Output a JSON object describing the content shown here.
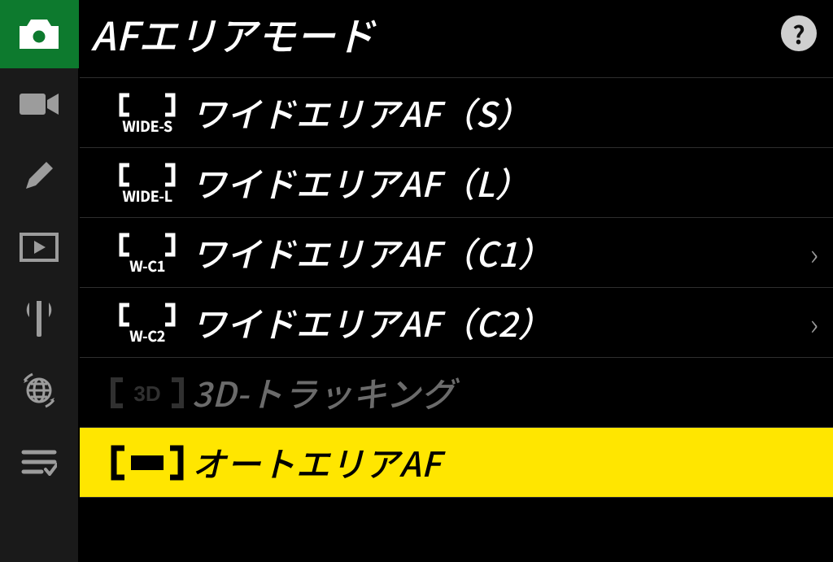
{
  "header": {
    "title": "AFエリアモード",
    "help_label": "?"
  },
  "sidebar": {
    "items": [
      {
        "name": "photo",
        "active": true
      },
      {
        "name": "video",
        "active": false
      },
      {
        "name": "edit",
        "active": false
      },
      {
        "name": "playback",
        "active": false
      },
      {
        "name": "setup",
        "active": false
      },
      {
        "name": "network",
        "active": false
      },
      {
        "name": "mymenu",
        "active": false
      }
    ]
  },
  "list": {
    "items": [
      {
        "icon_sub": "WIDE-S",
        "label": "ワイドエリアAF（S）",
        "has_sub": false,
        "disabled": false,
        "selected": false,
        "icon": "brackets-dots"
      },
      {
        "icon_sub": "WIDE-L",
        "label": "ワイドエリアAF（L）",
        "has_sub": false,
        "disabled": false,
        "selected": false,
        "icon": "brackets-dots"
      },
      {
        "icon_sub": "W-C1",
        "label": "ワイドエリアAF（C1）",
        "has_sub": true,
        "disabled": false,
        "selected": false,
        "icon": "brackets-dots"
      },
      {
        "icon_sub": "W-C2",
        "label": "ワイドエリアAF（C2）",
        "has_sub": true,
        "disabled": false,
        "selected": false,
        "icon": "brackets-dots"
      },
      {
        "icon_sub": "",
        "label": "3D-トラッキング",
        "has_sub": false,
        "disabled": true,
        "selected": false,
        "icon": "3d"
      },
      {
        "icon_sub": "",
        "label": "オートエリアAF",
        "has_sub": false,
        "disabled": false,
        "selected": true,
        "icon": "auto"
      }
    ]
  }
}
